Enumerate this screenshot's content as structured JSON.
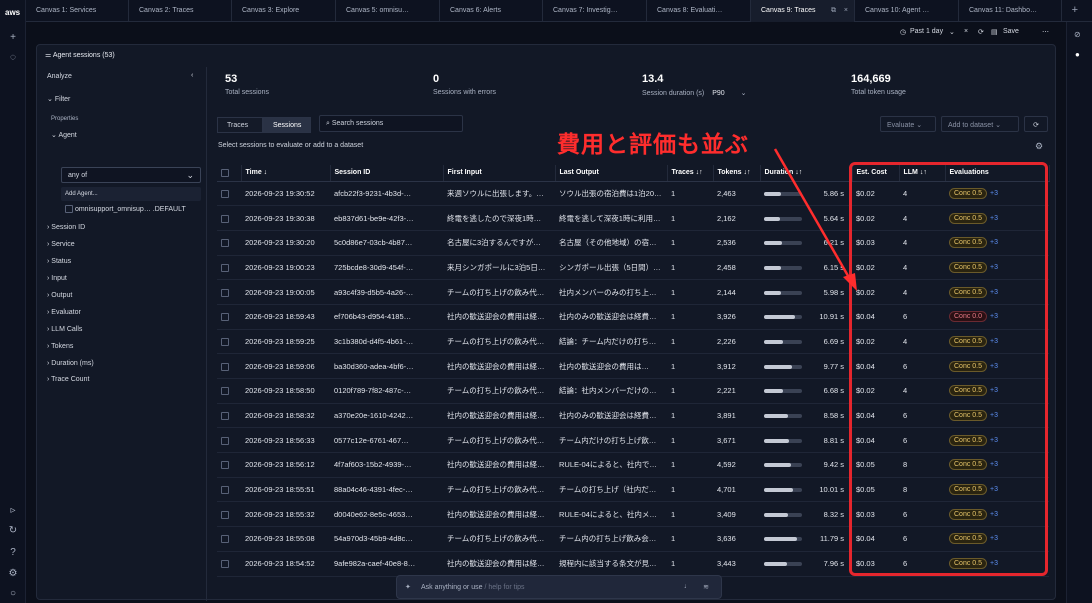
{
  "brand": "aws",
  "tabs": [
    "Canvas 1: Services",
    "Canvas 2: Traces",
    "Canvas 3: Explore",
    "Canvas 5: omnisu…",
    "Canvas 6: Alerts",
    "Canvas 7: Investig…",
    "Canvas 8: Evaluati…",
    "Canvas 9: Traces",
    "Canvas 10: Agent …",
    "Canvas 11: Dashbo…"
  ],
  "toolbar": {
    "range": "Past 1 day",
    "save": "Save"
  },
  "panel_title": "Agent sessions (53)",
  "sidebar": {
    "analyze": "Analyze",
    "filter": "Filter",
    "properties": "Properties",
    "agent": "Agent",
    "agent_select": "any of",
    "add_agent": "Add Agent...",
    "agent_option": "omnisupport_omnisup…",
    "agent_option_suffix": ".DEFAULT",
    "groups": [
      "Session ID",
      "Service",
      "Status",
      "Input",
      "Output",
      "Evaluator",
      "LLM Calls",
      "Tokens",
      "Duration (ms)",
      "Trace Count"
    ]
  },
  "stats": [
    {
      "value": "53",
      "label": "Total sessions"
    },
    {
      "value": "0",
      "label": "Sessions with errors"
    },
    {
      "value": "13.4",
      "label": "Session duration (s)",
      "extra": "P90"
    },
    {
      "value": "164,669",
      "label": "Total token usage"
    }
  ],
  "view": {
    "traces": "Traces",
    "sessions": "Sessions",
    "search_placeholder": "Search sessions",
    "evaluate": "Evaluate",
    "add_dataset": "Add to dataset",
    "hint": "Select sessions to evaluate or add to a dataset"
  },
  "columns": [
    "Time",
    "Session ID",
    "First Input",
    "Last Output",
    "Traces",
    "Tokens",
    "Duration",
    "Est. Cost",
    "LLM",
    "Evaluations"
  ],
  "rows": [
    [
      "2026-09-23 19:30:52",
      "afcb22f3-9231-4b3d-…",
      "来週ソウルに出張します。…",
      "ソウル出張の宿泊費は1泊20…",
      "1",
      "2,463",
      "5.86 s",
      "$0.02",
      "4",
      "Conc 0.5",
      "+3",
      0.45
    ],
    [
      "2026-09-23 19:30:38",
      "eb837d61-be9e-42f3-…",
      "終電を逃したので深夜1時…",
      "終電を逃して深夜1時に利用…",
      "1",
      "2,162",
      "5.64 s",
      "$0.02",
      "4",
      "Conc 0.5",
      "+3",
      0.43
    ],
    [
      "2026-09-23 19:30:20",
      "5c0d86e7-03cb-4b87…",
      "名古屋に3泊するんですが…",
      "名古屋（その他地域）の宿…",
      "1",
      "2,536",
      "6.21 s",
      "$0.03",
      "4",
      "Conc 0.5",
      "+3",
      0.47
    ],
    [
      "2026-09-23 19:00:23",
      "725bcde8-30d9-454f-…",
      "来月シンガポールに3泊5日…",
      "シンガポール出張（5日間）…",
      "1",
      "2,458",
      "6.15 s",
      "$0.02",
      "4",
      "Conc 0.5",
      "+3",
      0.46
    ],
    [
      "2026-09-23 19:00:05",
      "a93c4f39-d5b5-4a26-…",
      "チームの打ち上げの飲み代…",
      "社内メンバーのみの打ち上…",
      "1",
      "2,144",
      "5.98 s",
      "$0.02",
      "4",
      "Conc 0.5",
      "+3",
      0.45
    ],
    [
      "2026-09-23 18:59:43",
      "ef706b43-d954-4185…",
      "社内の歓送迎会の費用は経…",
      "社内のみの歓送迎会は経費…",
      "1",
      "3,926",
      "10.91 s",
      "$0.04",
      "6",
      "Conc 0.0",
      "+3",
      0.82
    ],
    [
      "2026-09-23 18:59:25",
      "3c1b380d-d4f5-4b61-…",
      "チームの打ち上げの飲み代…",
      "結論：チーム内だけの打ち…",
      "1",
      "2,226",
      "6.69 s",
      "$0.02",
      "4",
      "Conc 0.5",
      "+3",
      0.5
    ],
    [
      "2026-09-23 18:59:06",
      "ba30d360-adea-4bf6-…",
      "社内の歓送迎会の費用は経…",
      "社内の歓送迎会の費用は…",
      "1",
      "3,912",
      "9.77 s",
      "$0.04",
      "6",
      "Conc 0.5",
      "+3",
      0.73
    ],
    [
      "2026-09-23 18:58:50",
      "0120f789-7f82-487c-…",
      "チームの打ち上げの飲み代…",
      "結論：社内メンバーだけの…",
      "1",
      "2,221",
      "6.68 s",
      "$0.02",
      "4",
      "Conc 0.5",
      "+3",
      0.5
    ],
    [
      "2026-09-23 18:58:32",
      "a370e20e-1610-4242…",
      "社内の歓送迎会の費用は経…",
      "社内のみの歓送迎会は経費…",
      "1",
      "3,891",
      "8.58 s",
      "$0.04",
      "6",
      "Conc 0.5",
      "+3",
      0.64
    ],
    [
      "2026-09-23 18:56:33",
      "0577c12e-6761-467…",
      "チームの打ち上げの飲み代…",
      "チーム内だけの打ち上げ飲…",
      "1",
      "3,671",
      "8.81 s",
      "$0.04",
      "6",
      "Conc 0.5",
      "+3",
      0.66
    ],
    [
      "2026-09-23 18:56:12",
      "4f7af603-15b2-4939-…",
      "社内の歓送迎会の費用は経…",
      "RULE-04によると、社内で…",
      "1",
      "4,592",
      "9.42 s",
      "$0.05",
      "8",
      "Conc 0.5",
      "+3",
      0.7
    ],
    [
      "2026-09-23 18:55:51",
      "88a04c46-4391-4fec-…",
      "チームの打ち上げの飲み代…",
      "チームの打ち上げ（社内だ…",
      "1",
      "4,701",
      "10.01 s",
      "$0.05",
      "8",
      "Conc 0.5",
      "+3",
      0.75
    ],
    [
      "2026-09-23 18:55:32",
      "d0040e62-8e5c-4653…",
      "社内の歓送迎会の費用は経…",
      "RULE-04によると、社内メ…",
      "1",
      "3,409",
      "8.32 s",
      "$0.03",
      "6",
      "Conc 0.5",
      "+3",
      0.62
    ],
    [
      "2026-09-23 18:55:08",
      "54a970d3-45b9-4d8c…",
      "チームの打ち上げの飲み代…",
      "チーム内の打ち上げ飲み会…",
      "1",
      "3,636",
      "11.79 s",
      "$0.04",
      "6",
      "Conc 0.5",
      "+3",
      0.88
    ],
    [
      "2026-09-23 18:54:52",
      "9afe982a-caef-40e8-8…",
      "社内の歓送迎会の費用は経…",
      "規程内に該当する条文が見…",
      "1",
      "3,443",
      "7.96 s",
      "$0.03",
      "6",
      "Conc 0.5",
      "+3",
      0.6
    ]
  ],
  "annotation": "費用と評価も並ぶ",
  "ask": {
    "text": "Ask anything or use",
    "placeholder": "/ help for tips"
  }
}
